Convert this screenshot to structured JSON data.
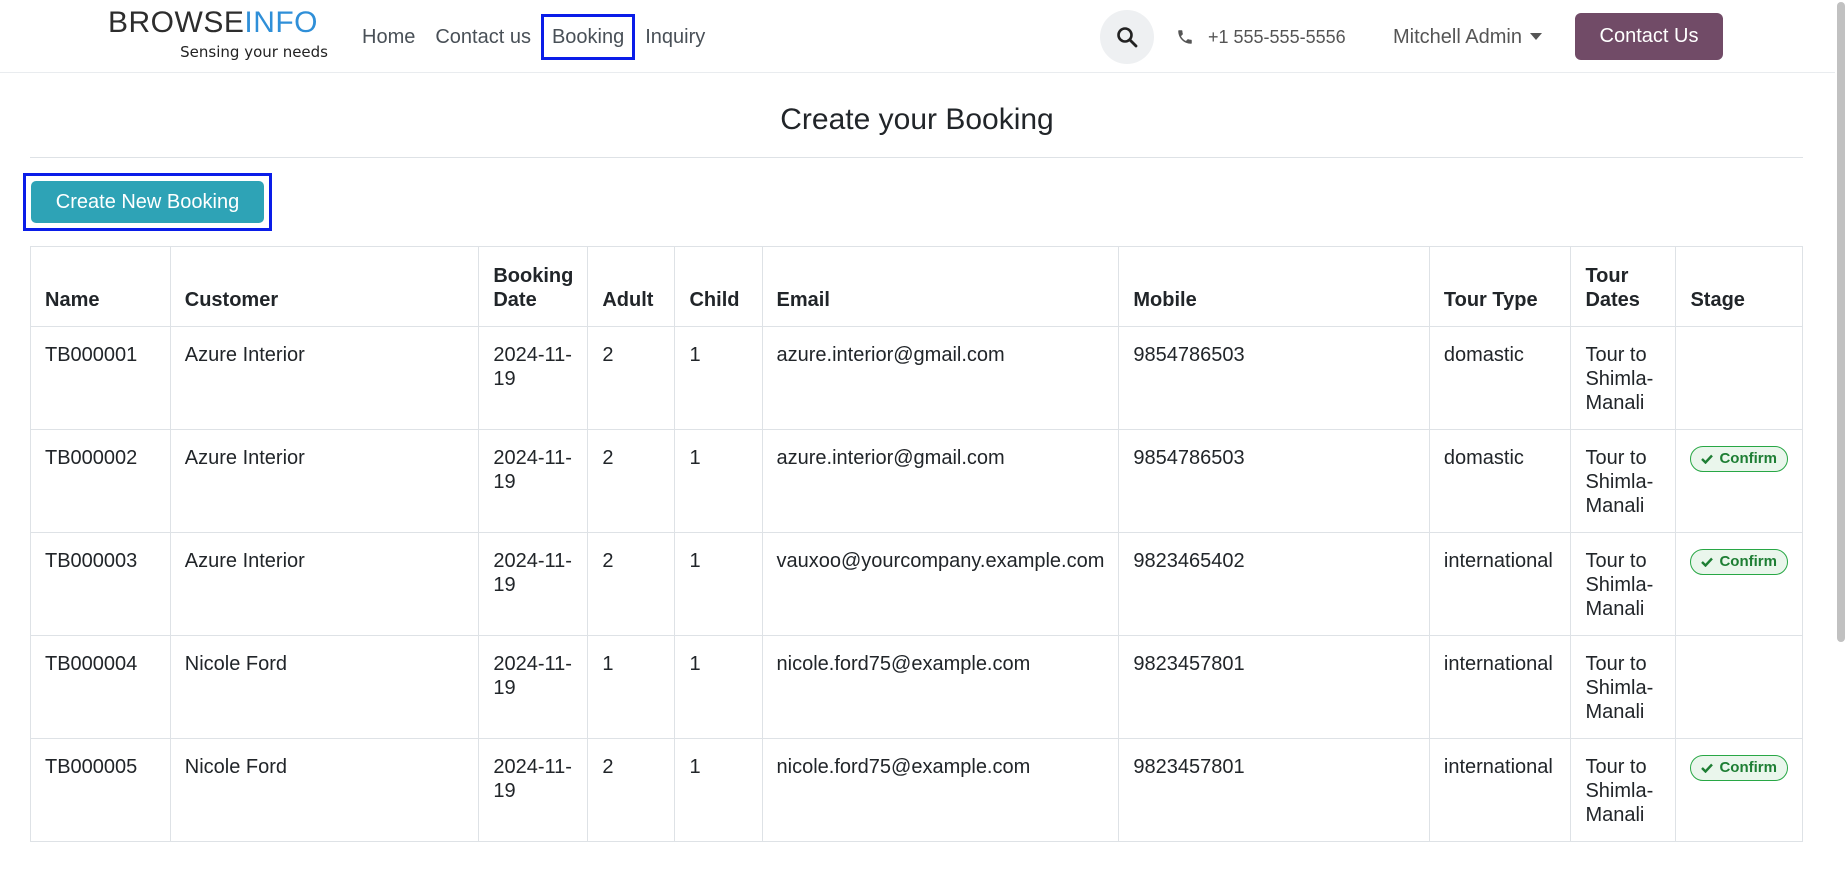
{
  "header": {
    "logo_brand_part1": "BROWSE",
    "logo_brand_part2": "INFO",
    "logo_tagline": "Sensing your needs",
    "nav": [
      {
        "label": "Home"
      },
      {
        "label": "Contact us"
      },
      {
        "label": "Booking",
        "active": true
      },
      {
        "label": "Inquiry"
      }
    ],
    "search_icon": "search-icon",
    "phone": "+1 555-555-5556",
    "user": "Mitchell Admin",
    "contact_button": "Contact Us",
    "accent_color": "#714b67"
  },
  "page": {
    "title": "Create your Booking",
    "create_button": "Create New Booking",
    "create_button_color": "#2ea3b6"
  },
  "table": {
    "headers": {
      "name": "Name",
      "customer": "Customer",
      "booking_date": "Booking Date",
      "adult": "Adult",
      "child": "Child",
      "email": "Email",
      "mobile": "Mobile",
      "tour_type": "Tour Type",
      "tour_dates": "Tour Dates",
      "stage": "Stage"
    },
    "rows": [
      {
        "name": "TB000001",
        "customer": "Azure Interior",
        "booking_date": "2024-11-19",
        "adult": "2",
        "child": "1",
        "email": "azure.interior@gmail.com",
        "mobile": "9854786503",
        "tour_type": "domastic",
        "tour_dates": "Tour to Shimla-Manali",
        "stage": ""
      },
      {
        "name": "TB000002",
        "customer": "Azure Interior",
        "booking_date": "2024-11-19",
        "adult": "2",
        "child": "1",
        "email": "azure.interior@gmail.com",
        "mobile": "9854786503",
        "tour_type": "domastic",
        "tour_dates": "Tour to Shimla-Manali",
        "stage": "Confirm"
      },
      {
        "name": "TB000003",
        "customer": "Azure Interior",
        "booking_date": "2024-11-19",
        "adult": "2",
        "child": "1",
        "email": "vauxoo@yourcompany.example.com",
        "mobile": "9823465402",
        "tour_type": "international",
        "tour_dates": "Tour to Shimla-Manali",
        "stage": "Confirm"
      },
      {
        "name": "TB000004",
        "customer": "Nicole Ford",
        "booking_date": "2024-11-19",
        "adult": "1",
        "child": "1",
        "email": "nicole.ford75@example.com",
        "mobile": "9823457801",
        "tour_type": "international",
        "tour_dates": "Tour to Shimla-Manali",
        "stage": ""
      },
      {
        "name": "TB000005",
        "customer": "Nicole Ford",
        "booking_date": "2024-11-19",
        "adult": "2",
        "child": "1",
        "email": "nicole.ford75@example.com",
        "mobile": "9823457801",
        "tour_type": "international",
        "tour_dates": "Tour to Shimla-Manali",
        "stage": "Confirm"
      }
    ],
    "stage_badge_color": "#28a745"
  }
}
